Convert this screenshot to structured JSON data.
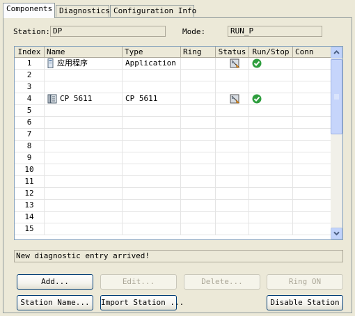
{
  "tabs": [
    {
      "label": "Components",
      "active": true
    },
    {
      "label": "Diagnostics",
      "active": false
    },
    {
      "label": "Configuration Info",
      "active": false
    }
  ],
  "station": {
    "label": "Station:",
    "value": "DP"
  },
  "mode": {
    "label": "Mode:",
    "value": "RUN_P"
  },
  "grid": {
    "columns": [
      "Index",
      "Name",
      "Type",
      "Ring",
      "Status",
      "Run/Stop",
      "Conn"
    ],
    "rows": [
      {
        "index": "1",
        "name": "应用程序",
        "type": "Application",
        "ring": "",
        "status_icon": "station-status-icon",
        "runstop_icon": "run-check-icon",
        "name_icon": "application-icon"
      },
      {
        "index": "2",
        "name": "",
        "type": "",
        "ring": ""
      },
      {
        "index": "3",
        "name": "",
        "type": "",
        "ring": ""
      },
      {
        "index": "4",
        "name": "CP 5611",
        "type": "CP 5611",
        "ring": "",
        "status_icon": "station-status-icon",
        "runstop_icon": "run-check-icon",
        "name_icon": "network-card-icon"
      },
      {
        "index": "5",
        "name": "",
        "type": "",
        "ring": ""
      },
      {
        "index": "6",
        "name": "",
        "type": "",
        "ring": ""
      },
      {
        "index": "7",
        "name": "",
        "type": "",
        "ring": ""
      },
      {
        "index": "8",
        "name": "",
        "type": "",
        "ring": ""
      },
      {
        "index": "9",
        "name": "",
        "type": "",
        "ring": ""
      },
      {
        "index": "10",
        "name": "",
        "type": "",
        "ring": ""
      },
      {
        "index": "11",
        "name": "",
        "type": "",
        "ring": ""
      },
      {
        "index": "12",
        "name": "",
        "type": "",
        "ring": ""
      },
      {
        "index": "13",
        "name": "",
        "type": "",
        "ring": ""
      },
      {
        "index": "14",
        "name": "",
        "type": "",
        "ring": ""
      },
      {
        "index": "15",
        "name": "",
        "type": "",
        "ring": ""
      }
    ]
  },
  "status_message": "New diagnostic entry arrived!",
  "buttons": {
    "add": {
      "label": "Add...",
      "enabled": true
    },
    "edit": {
      "label": "Edit...",
      "enabled": false
    },
    "delete": {
      "label": "Delete...",
      "enabled": false
    },
    "ring_on": {
      "label": "Ring ON",
      "enabled": false
    },
    "station_name": {
      "label": "Station Name...",
      "enabled": true
    },
    "import_station": {
      "label": "Import Station ...",
      "enabled": true
    },
    "disable_station": {
      "label": "Disable Station",
      "enabled": true
    }
  },
  "colors": {
    "ok_green": "#2e9e3e",
    "background": "#ece9d8"
  }
}
